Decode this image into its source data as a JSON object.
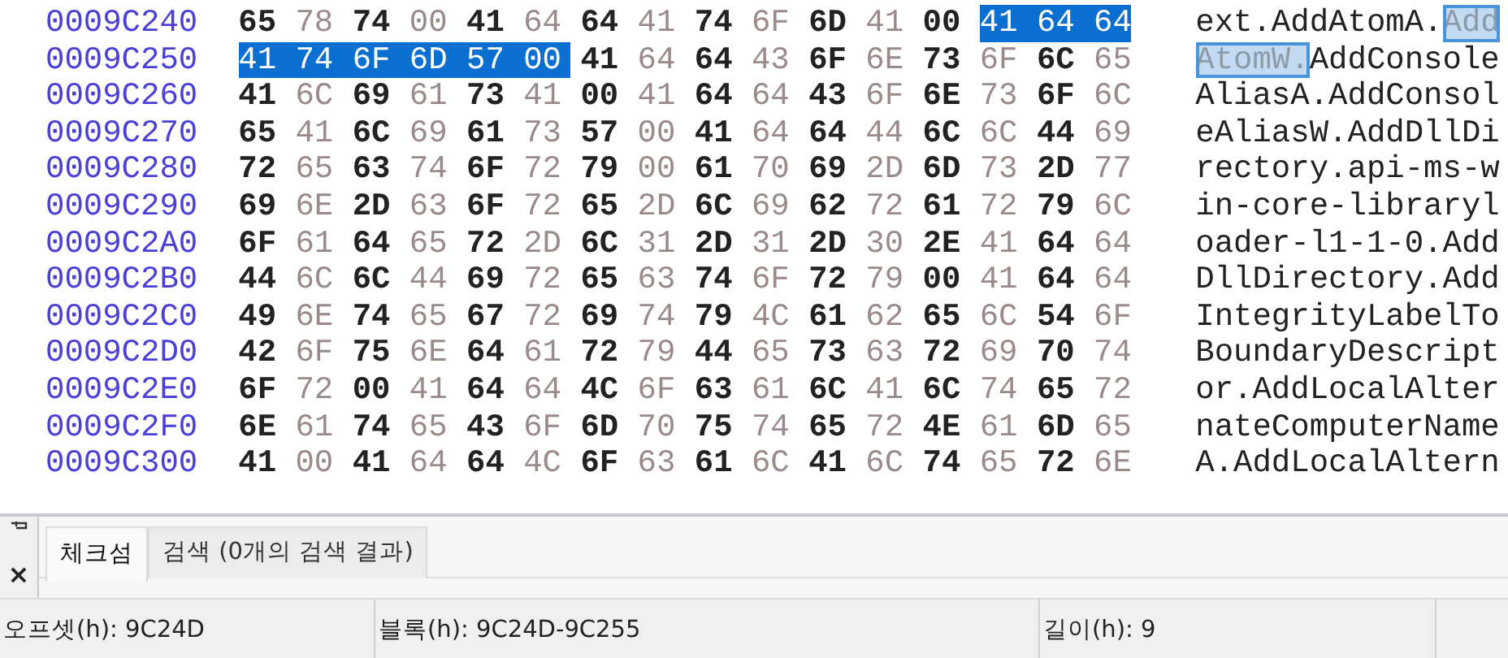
{
  "hex_view": {
    "rows": [
      {
        "offset": "0009C240",
        "bytes": [
          {
            "hex": "65",
            "selected": false
          },
          {
            "hex": "78",
            "selected": false
          },
          {
            "hex": "74",
            "selected": false
          },
          {
            "hex": "00",
            "selected": false
          },
          {
            "hex": "41",
            "selected": false
          },
          {
            "hex": "64",
            "selected": false
          },
          {
            "hex": "64",
            "selected": false
          },
          {
            "hex": "41",
            "selected": false
          },
          {
            "hex": "74",
            "selected": false
          },
          {
            "hex": "6F",
            "selected": false
          },
          {
            "hex": "6D",
            "selected": false
          },
          {
            "hex": "41",
            "selected": false
          },
          {
            "hex": "00",
            "selected": false
          },
          {
            "hex": "41",
            "selected": true
          },
          {
            "hex": "64",
            "selected": true
          },
          {
            "hex": "64",
            "selected": true
          }
        ],
        "ascii": "ext.AddAtomA.Add"
      },
      {
        "offset": "0009C250",
        "bytes": [
          {
            "hex": "41",
            "selected": true
          },
          {
            "hex": "74",
            "selected": true
          },
          {
            "hex": "6F",
            "selected": true
          },
          {
            "hex": "6D",
            "selected": true
          },
          {
            "hex": "57",
            "selected": true
          },
          {
            "hex": "00",
            "selected": true
          },
          {
            "hex": "41",
            "selected": false
          },
          {
            "hex": "64",
            "selected": false
          },
          {
            "hex": "64",
            "selected": false
          },
          {
            "hex": "43",
            "selected": false
          },
          {
            "hex": "6F",
            "selected": false
          },
          {
            "hex": "6E",
            "selected": false
          },
          {
            "hex": "73",
            "selected": false
          },
          {
            "hex": "6F",
            "selected": false
          },
          {
            "hex": "6C",
            "selected": false
          },
          {
            "hex": "65",
            "selected": false
          }
        ],
        "ascii": "AtomW.AddConsole"
      },
      {
        "offset": "0009C260",
        "bytes": [
          {
            "hex": "41",
            "selected": false
          },
          {
            "hex": "6C",
            "selected": false
          },
          {
            "hex": "69",
            "selected": false
          },
          {
            "hex": "61",
            "selected": false
          },
          {
            "hex": "73",
            "selected": false
          },
          {
            "hex": "41",
            "selected": false
          },
          {
            "hex": "00",
            "selected": false
          },
          {
            "hex": "41",
            "selected": false
          },
          {
            "hex": "64",
            "selected": false
          },
          {
            "hex": "64",
            "selected": false
          },
          {
            "hex": "43",
            "selected": false
          },
          {
            "hex": "6F",
            "selected": false
          },
          {
            "hex": "6E",
            "selected": false
          },
          {
            "hex": "73",
            "selected": false
          },
          {
            "hex": "6F",
            "selected": false
          },
          {
            "hex": "6C",
            "selected": false
          }
        ],
        "ascii": "AliasA.AddConsol"
      },
      {
        "offset": "0009C270",
        "bytes": [
          {
            "hex": "65",
            "selected": false
          },
          {
            "hex": "41",
            "selected": false
          },
          {
            "hex": "6C",
            "selected": false
          },
          {
            "hex": "69",
            "selected": false
          },
          {
            "hex": "61",
            "selected": false
          },
          {
            "hex": "73",
            "selected": false
          },
          {
            "hex": "57",
            "selected": false
          },
          {
            "hex": "00",
            "selected": false
          },
          {
            "hex": "41",
            "selected": false
          },
          {
            "hex": "64",
            "selected": false
          },
          {
            "hex": "64",
            "selected": false
          },
          {
            "hex": "44",
            "selected": false
          },
          {
            "hex": "6C",
            "selected": false
          },
          {
            "hex": "6C",
            "selected": false
          },
          {
            "hex": "44",
            "selected": false
          },
          {
            "hex": "69",
            "selected": false
          }
        ],
        "ascii": "eAliasW.AddDllDi"
      },
      {
        "offset": "0009C280",
        "bytes": [
          {
            "hex": "72",
            "selected": false
          },
          {
            "hex": "65",
            "selected": false
          },
          {
            "hex": "63",
            "selected": false
          },
          {
            "hex": "74",
            "selected": false
          },
          {
            "hex": "6F",
            "selected": false
          },
          {
            "hex": "72",
            "selected": false
          },
          {
            "hex": "79",
            "selected": false
          },
          {
            "hex": "00",
            "selected": false
          },
          {
            "hex": "61",
            "selected": false
          },
          {
            "hex": "70",
            "selected": false
          },
          {
            "hex": "69",
            "selected": false
          },
          {
            "hex": "2D",
            "selected": false
          },
          {
            "hex": "6D",
            "selected": false
          },
          {
            "hex": "73",
            "selected": false
          },
          {
            "hex": "2D",
            "selected": false
          },
          {
            "hex": "77",
            "selected": false
          }
        ],
        "ascii": "rectory.api-ms-w"
      },
      {
        "offset": "0009C290",
        "bytes": [
          {
            "hex": "69",
            "selected": false
          },
          {
            "hex": "6E",
            "selected": false
          },
          {
            "hex": "2D",
            "selected": false
          },
          {
            "hex": "63",
            "selected": false
          },
          {
            "hex": "6F",
            "selected": false
          },
          {
            "hex": "72",
            "selected": false
          },
          {
            "hex": "65",
            "selected": false
          },
          {
            "hex": "2D",
            "selected": false
          },
          {
            "hex": "6C",
            "selected": false
          },
          {
            "hex": "69",
            "selected": false
          },
          {
            "hex": "62",
            "selected": false
          },
          {
            "hex": "72",
            "selected": false
          },
          {
            "hex": "61",
            "selected": false
          },
          {
            "hex": "72",
            "selected": false
          },
          {
            "hex": "79",
            "selected": false
          },
          {
            "hex": "6C",
            "selected": false
          }
        ],
        "ascii": "in-core-libraryl"
      },
      {
        "offset": "0009C2A0",
        "bytes": [
          {
            "hex": "6F",
            "selected": false
          },
          {
            "hex": "61",
            "selected": false
          },
          {
            "hex": "64",
            "selected": false
          },
          {
            "hex": "65",
            "selected": false
          },
          {
            "hex": "72",
            "selected": false
          },
          {
            "hex": "2D",
            "selected": false
          },
          {
            "hex": "6C",
            "selected": false
          },
          {
            "hex": "31",
            "selected": false
          },
          {
            "hex": "2D",
            "selected": false
          },
          {
            "hex": "31",
            "selected": false
          },
          {
            "hex": "2D",
            "selected": false
          },
          {
            "hex": "30",
            "selected": false
          },
          {
            "hex": "2E",
            "selected": false
          },
          {
            "hex": "41",
            "selected": false
          },
          {
            "hex": "64",
            "selected": false
          },
          {
            "hex": "64",
            "selected": false
          }
        ],
        "ascii": "oader-l1-1-0.Add"
      },
      {
        "offset": "0009C2B0",
        "bytes": [
          {
            "hex": "44",
            "selected": false
          },
          {
            "hex": "6C",
            "selected": false
          },
          {
            "hex": "6C",
            "selected": false
          },
          {
            "hex": "44",
            "selected": false
          },
          {
            "hex": "69",
            "selected": false
          },
          {
            "hex": "72",
            "selected": false
          },
          {
            "hex": "65",
            "selected": false
          },
          {
            "hex": "63",
            "selected": false
          },
          {
            "hex": "74",
            "selected": false
          },
          {
            "hex": "6F",
            "selected": false
          },
          {
            "hex": "72",
            "selected": false
          },
          {
            "hex": "79",
            "selected": false
          },
          {
            "hex": "00",
            "selected": false
          },
          {
            "hex": "41",
            "selected": false
          },
          {
            "hex": "64",
            "selected": false
          },
          {
            "hex": "64",
            "selected": false
          }
        ],
        "ascii": "DllDirectory.Add"
      },
      {
        "offset": "0009C2C0",
        "bytes": [
          {
            "hex": "49",
            "selected": false
          },
          {
            "hex": "6E",
            "selected": false
          },
          {
            "hex": "74",
            "selected": false
          },
          {
            "hex": "65",
            "selected": false
          },
          {
            "hex": "67",
            "selected": false
          },
          {
            "hex": "72",
            "selected": false
          },
          {
            "hex": "69",
            "selected": false
          },
          {
            "hex": "74",
            "selected": false
          },
          {
            "hex": "79",
            "selected": false
          },
          {
            "hex": "4C",
            "selected": false
          },
          {
            "hex": "61",
            "selected": false
          },
          {
            "hex": "62",
            "selected": false
          },
          {
            "hex": "65",
            "selected": false
          },
          {
            "hex": "6C",
            "selected": false
          },
          {
            "hex": "54",
            "selected": false
          },
          {
            "hex": "6F",
            "selected": false
          }
        ],
        "ascii": "IntegrityLabelTo"
      },
      {
        "offset": "0009C2D0",
        "bytes": [
          {
            "hex": "42",
            "selected": false
          },
          {
            "hex": "6F",
            "selected": false
          },
          {
            "hex": "75",
            "selected": false
          },
          {
            "hex": "6E",
            "selected": false
          },
          {
            "hex": "64",
            "selected": false
          },
          {
            "hex": "61",
            "selected": false
          },
          {
            "hex": "72",
            "selected": false
          },
          {
            "hex": "79",
            "selected": false
          },
          {
            "hex": "44",
            "selected": false
          },
          {
            "hex": "65",
            "selected": false
          },
          {
            "hex": "73",
            "selected": false
          },
          {
            "hex": "63",
            "selected": false
          },
          {
            "hex": "72",
            "selected": false
          },
          {
            "hex": "69",
            "selected": false
          },
          {
            "hex": "70",
            "selected": false
          },
          {
            "hex": "74",
            "selected": false
          }
        ],
        "ascii": "BoundaryDescript"
      },
      {
        "offset": "0009C2E0",
        "bytes": [
          {
            "hex": "6F",
            "selected": false
          },
          {
            "hex": "72",
            "selected": false
          },
          {
            "hex": "00",
            "selected": false
          },
          {
            "hex": "41",
            "selected": false
          },
          {
            "hex": "64",
            "selected": false
          },
          {
            "hex": "64",
            "selected": false
          },
          {
            "hex": "4C",
            "selected": false
          },
          {
            "hex": "6F",
            "selected": false
          },
          {
            "hex": "63",
            "selected": false
          },
          {
            "hex": "61",
            "selected": false
          },
          {
            "hex": "6C",
            "selected": false
          },
          {
            "hex": "41",
            "selected": false
          },
          {
            "hex": "6C",
            "selected": false
          },
          {
            "hex": "74",
            "selected": false
          },
          {
            "hex": "65",
            "selected": false
          },
          {
            "hex": "72",
            "selected": false
          }
        ],
        "ascii": "or.AddLocalAlter"
      },
      {
        "offset": "0009C2F0",
        "bytes": [
          {
            "hex": "6E",
            "selected": false
          },
          {
            "hex": "61",
            "selected": false
          },
          {
            "hex": "74",
            "selected": false
          },
          {
            "hex": "65",
            "selected": false
          },
          {
            "hex": "43",
            "selected": false
          },
          {
            "hex": "6F",
            "selected": false
          },
          {
            "hex": "6D",
            "selected": false
          },
          {
            "hex": "70",
            "selected": false
          },
          {
            "hex": "75",
            "selected": false
          },
          {
            "hex": "74",
            "selected": false
          },
          {
            "hex": "65",
            "selected": false
          },
          {
            "hex": "72",
            "selected": false
          },
          {
            "hex": "4E",
            "selected": false
          },
          {
            "hex": "61",
            "selected": false
          },
          {
            "hex": "6D",
            "selected": false
          },
          {
            "hex": "65",
            "selected": false
          }
        ],
        "ascii": "nateComputerName"
      },
      {
        "offset": "0009C300",
        "bytes": [
          {
            "hex": "41",
            "selected": false
          },
          {
            "hex": "00",
            "selected": false
          },
          {
            "hex": "41",
            "selected": false
          },
          {
            "hex": "64",
            "selected": false
          },
          {
            "hex": "64",
            "selected": false
          },
          {
            "hex": "4C",
            "selected": false
          },
          {
            "hex": "6F",
            "selected": false
          },
          {
            "hex": "63",
            "selected": false
          },
          {
            "hex": "61",
            "selected": false
          },
          {
            "hex": "6C",
            "selected": false
          },
          {
            "hex": "41",
            "selected": false
          },
          {
            "hex": "6C",
            "selected": false
          },
          {
            "hex": "74",
            "selected": false
          },
          {
            "hex": "65",
            "selected": false
          },
          {
            "hex": "72",
            "selected": false
          },
          {
            "hex": "6E",
            "selected": false
          }
        ],
        "ascii": "A.AddLocalAltern"
      }
    ]
  },
  "bottom_panel": {
    "close_glyph": "×",
    "tabs": [
      {
        "label": "체크섬",
        "selected": true
      },
      {
        "label": "검색 (0개의 검색 결과)",
        "selected": false
      }
    ]
  },
  "status_bar": [
    {
      "text": "오프셋(h): 9C24D"
    },
    {
      "text": "블록(h): 9C24D-9C255"
    },
    {
      "text": "길이(h): 9"
    }
  ]
}
